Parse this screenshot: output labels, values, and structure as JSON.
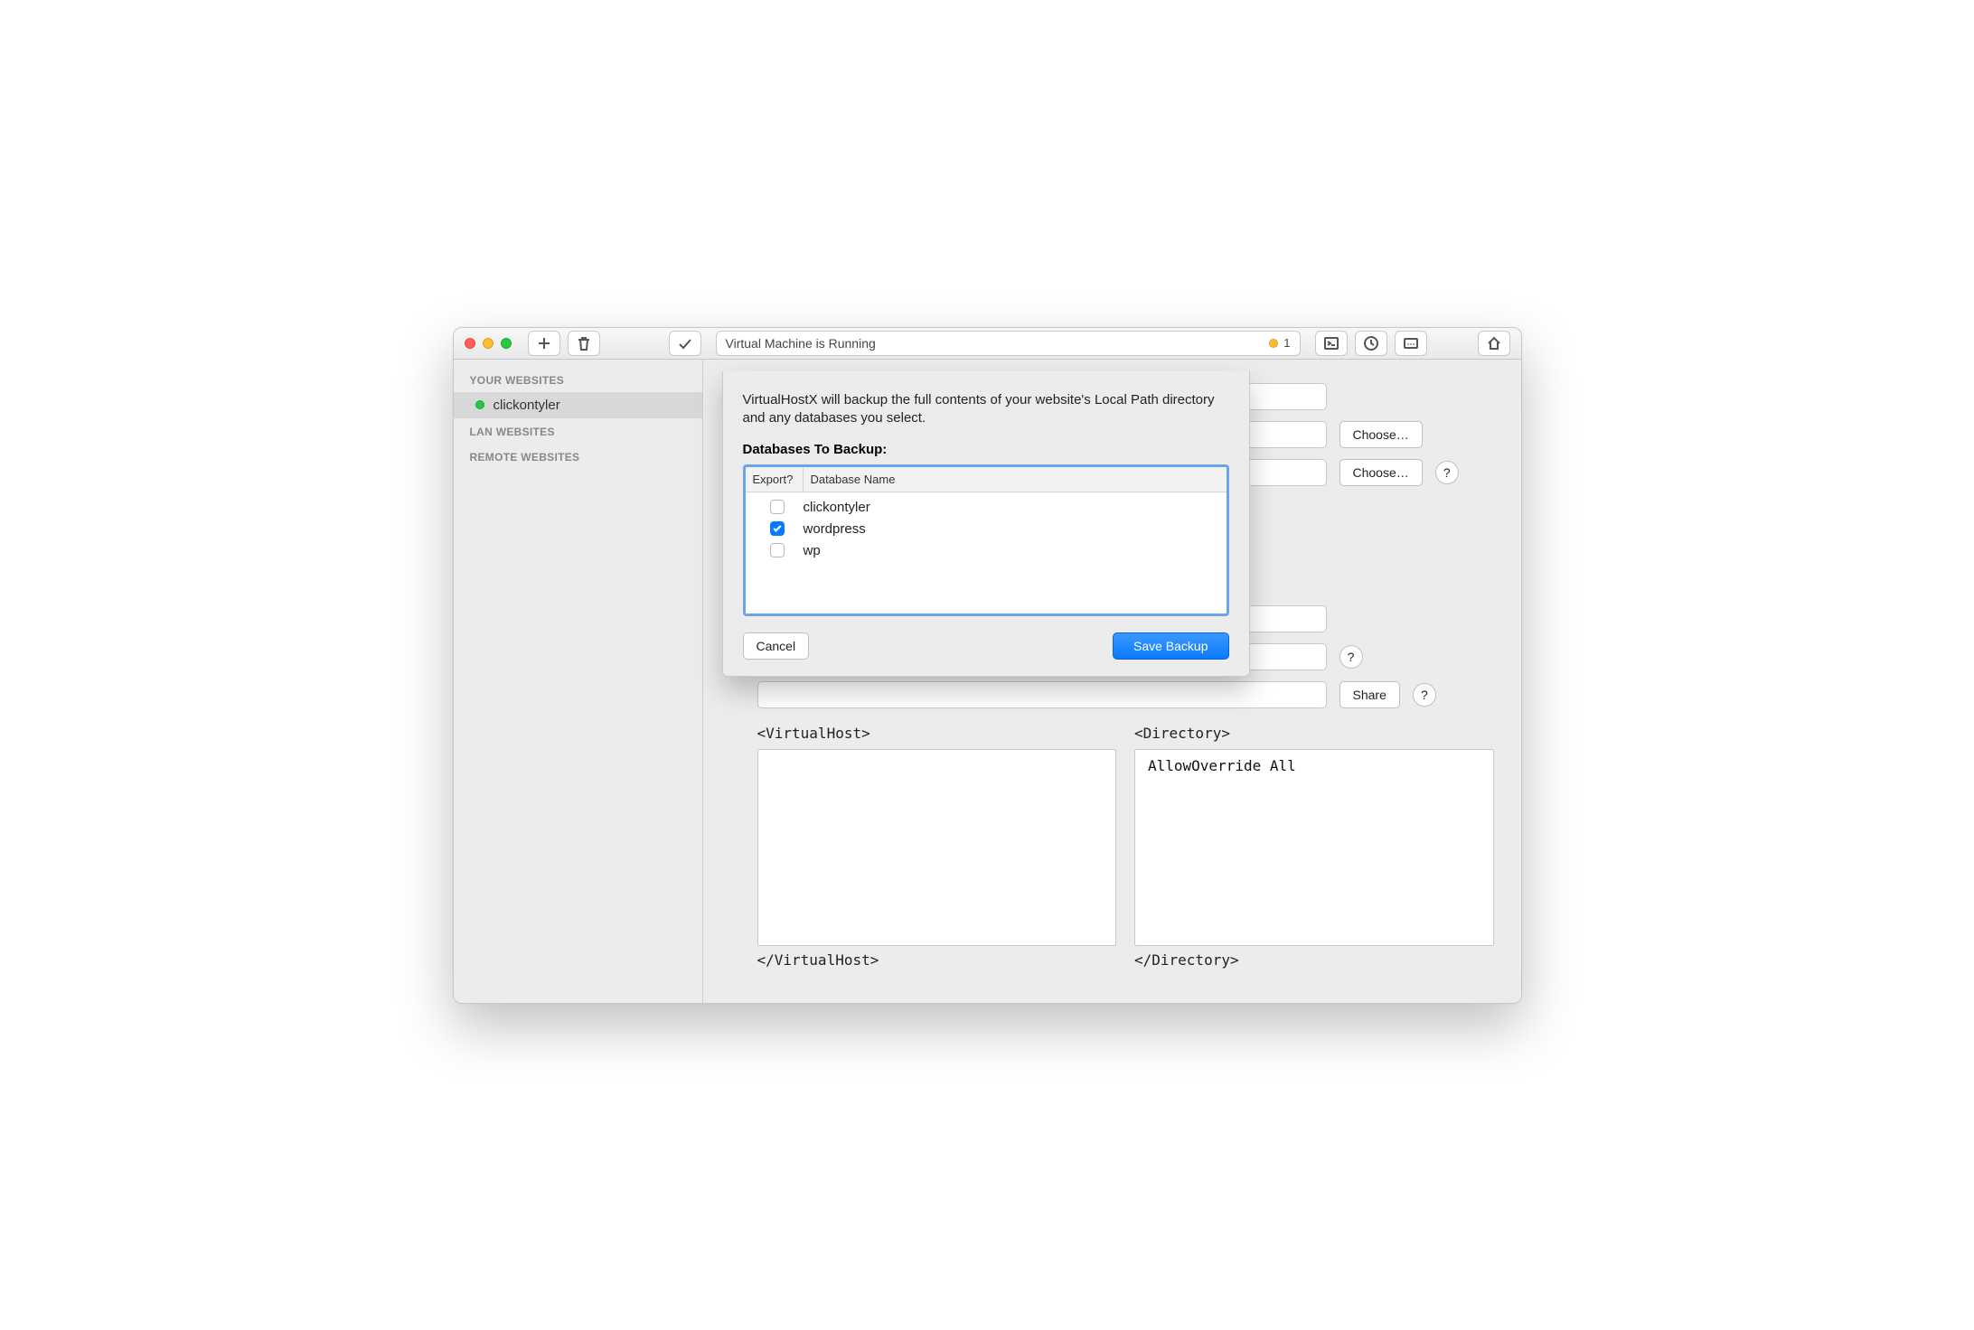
{
  "toolbar": {
    "address_text": "Virtual Machine is Running",
    "vm_count": "1"
  },
  "sidebar": {
    "sections": [
      {
        "label": "YOUR WEBSITES"
      },
      {
        "label": "LAN WEBSITES"
      },
      {
        "label": "REMOTE WEBSITES"
      }
    ],
    "site": "clickontyler"
  },
  "main": {
    "choose_label": "Choose…",
    "share_label": "Share",
    "help_label": "?",
    "vhost_open": "<VirtualHost>",
    "vhost_close": "</VirtualHost>",
    "dir_open": "<Directory>",
    "dir_close": "</Directory>",
    "dir_content": "AllowOverride All"
  },
  "sheet": {
    "description": "VirtualHostX will backup the full contents of your website's Local Path directory and any databases you select.",
    "subtitle": "Databases To Backup:",
    "col_export": "Export?",
    "col_name": "Database Name",
    "rows": [
      {
        "name": "clickontyler",
        "checked": false
      },
      {
        "name": "wordpress",
        "checked": true
      },
      {
        "name": "wp",
        "checked": false
      }
    ],
    "cancel": "Cancel",
    "save": "Save Backup"
  }
}
